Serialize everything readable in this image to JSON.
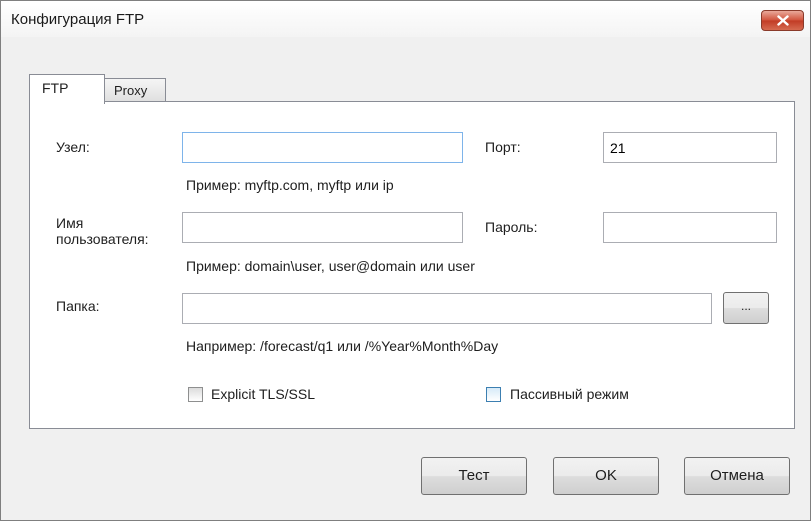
{
  "window": {
    "title": "Конфигурация FTP"
  },
  "tabs": [
    {
      "label": "FTP",
      "selected": true
    },
    {
      "label": "Proxy",
      "selected": false
    }
  ],
  "ftp": {
    "host_label": "Узел:",
    "host_value": "",
    "host_hint": "Пример: myftp.com, myftp или ip",
    "port_label": "Порт:",
    "port_value": "21",
    "user_label_line1": "Имя",
    "user_label_line2": "пользователя:",
    "user_value": "",
    "user_hint": "Пример: domain\\user, user@domain или user",
    "password_label": "Пароль:",
    "password_value": "",
    "folder_label": "Папка:",
    "folder_value": "",
    "folder_hint": "Например: /forecast/q1 или /%Year%Month%Day",
    "browse_label": "...",
    "tls_label": "Explicit TLS/SSL",
    "tls_checked": false,
    "passive_label": "Пассивный режим",
    "passive_checked": false
  },
  "buttons": {
    "test": "Тест",
    "ok": "OK",
    "cancel": "Отмена"
  },
  "icons": {
    "close": "close-icon"
  }
}
